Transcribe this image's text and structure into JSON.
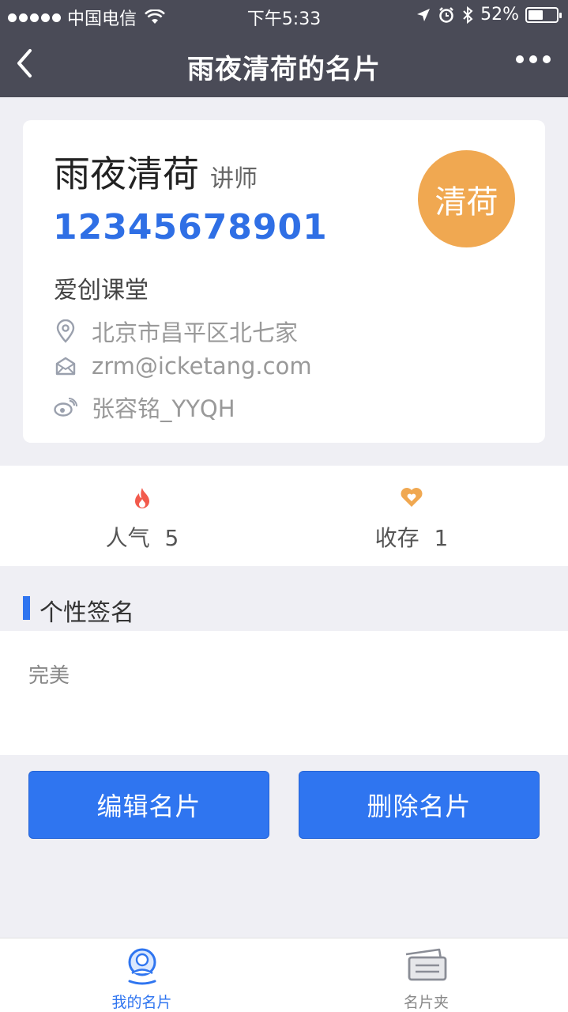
{
  "status_bar": {
    "carrier": "中国电信",
    "time": "下午5:33",
    "battery_percent": "52%",
    "battery_level": 0.52
  },
  "nav": {
    "title": "雨夜清荷的名片"
  },
  "card": {
    "name": "雨夜清荷",
    "role": "讲师",
    "phone": "12345678901",
    "company": "爱创课堂",
    "address": "北京市昌平区北七家",
    "email": "zrm@icketang.com",
    "weibo": "张容铭_YYQH",
    "avatar_text": "清荷",
    "avatar_color": "#f0a851",
    "phone_color": "#2f6fe5"
  },
  "stats": {
    "popularity_label": "人气",
    "popularity_value": "5",
    "favorite_label": "收存",
    "favorite_value": "1",
    "popularity_icon": "flame-icon",
    "favorite_icon": "heart-icon"
  },
  "signature": {
    "heading": "个性签名",
    "text": "完美"
  },
  "actions": {
    "edit_label": "编辑名片",
    "delete_label": "删除名片",
    "accent": "#2f75f0"
  },
  "tabbar": {
    "tabs": [
      {
        "label": "我的名片",
        "icon": "user-card-icon",
        "active": true
      },
      {
        "label": "名片夹",
        "icon": "card-holder-icon",
        "active": false
      }
    ],
    "active_color": "#2f75f0",
    "inactive_color": "#888888"
  }
}
